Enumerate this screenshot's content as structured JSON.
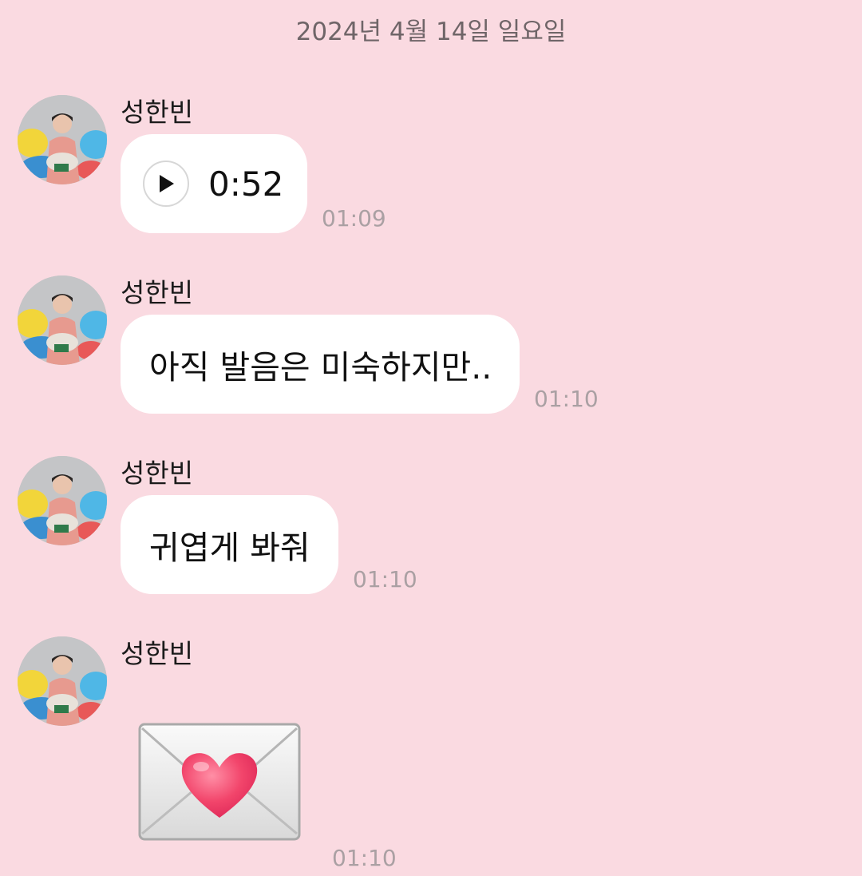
{
  "date_divider": "2024년 4월 14일 일요일",
  "messages": [
    {
      "sender": "성한빈",
      "type": "voice",
      "duration": "0:52",
      "time": "01:09"
    },
    {
      "sender": "성한빈",
      "type": "text",
      "text": "아직 발음은 미숙하지만..",
      "time": "01:10"
    },
    {
      "sender": "성한빈",
      "type": "text",
      "text": "귀엽게 봐줘",
      "time": "01:10"
    },
    {
      "sender": "성한빈",
      "type": "emoji",
      "emoji": "love-letter-envelope",
      "time": "01:10"
    }
  ],
  "icons": {
    "play": "play-icon",
    "avatar": "profile-photo"
  },
  "colors": {
    "background": "#fadae1",
    "bubble": "#ffffff",
    "timestamp": "#aaa0a3",
    "heart": "#f2456b"
  }
}
